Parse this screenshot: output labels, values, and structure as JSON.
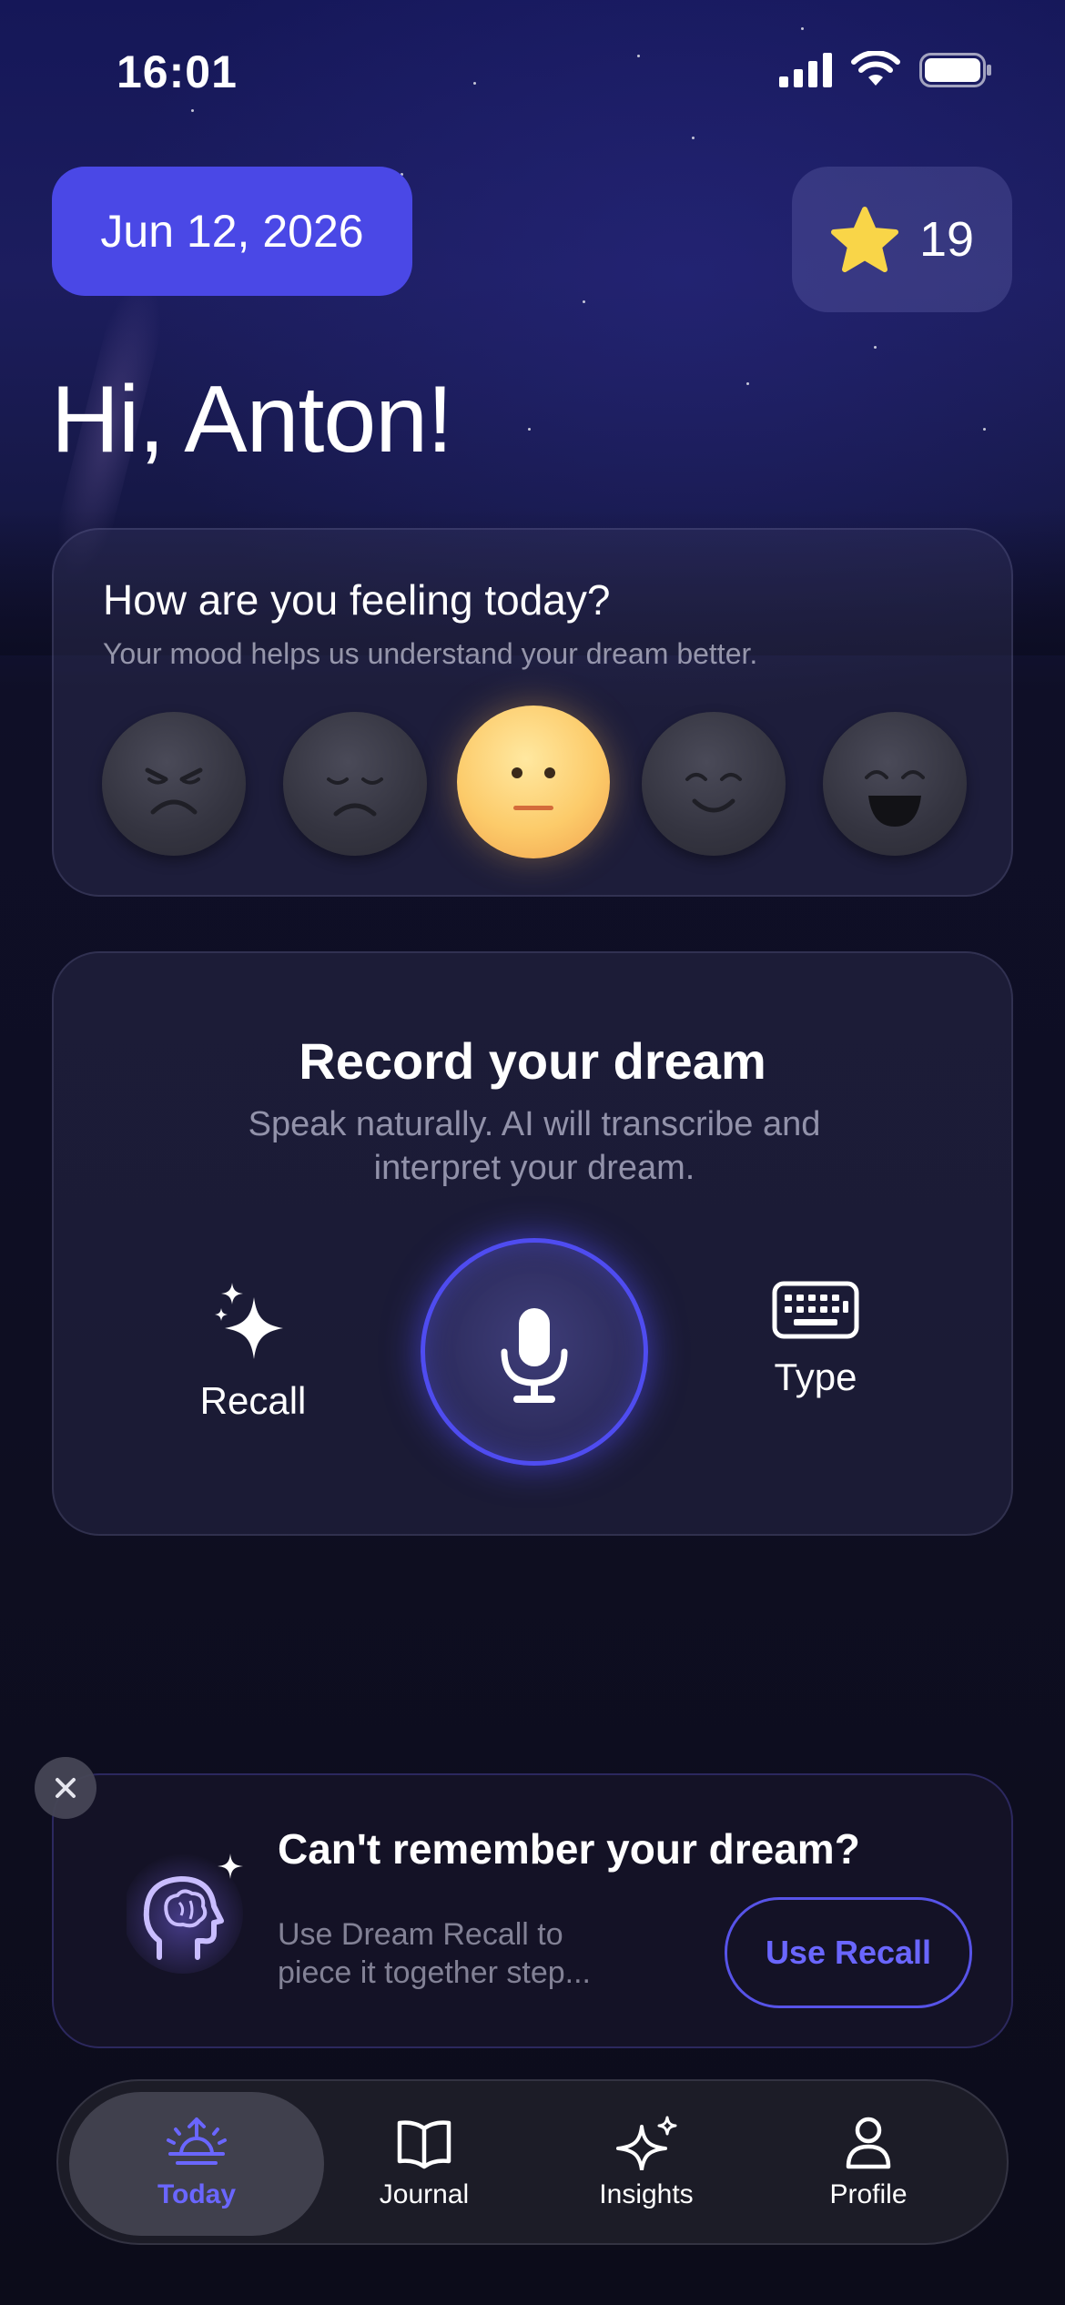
{
  "status_bar": {
    "time": "16:01",
    "icons": [
      "signal-icon",
      "wifi-icon",
      "battery-icon"
    ]
  },
  "header": {
    "date": "Jun 12, 2026",
    "stars_count": "19",
    "greeting": "Hi, Anton!"
  },
  "mood": {
    "title": "How are you feeling today?",
    "subtitle": "Your mood helps us understand your dream better.",
    "options": [
      "angry",
      "sad",
      "neutral",
      "content",
      "happy"
    ],
    "selected": "neutral"
  },
  "record": {
    "title": "Record your dream",
    "subtitle": "Speak naturally. AI will transcribe and interpret your dream.",
    "recall_label": "Recall",
    "type_label": "Type"
  },
  "recall_banner": {
    "title": "Can't remember your dream?",
    "subtitle": "Use Dream Recall to piece it together step...",
    "button_label": "Use Recall"
  },
  "tabs": [
    {
      "label": "Today",
      "icon": "sunrise-icon",
      "active": true
    },
    {
      "label": "Journal",
      "icon": "book-icon",
      "active": false
    },
    {
      "label": "Insights",
      "icon": "sparkles-icon",
      "active": false
    },
    {
      "label": "Profile",
      "icon": "person-icon",
      "active": false
    }
  ],
  "colors": {
    "accent": "#4a48e6",
    "accent_text": "#6a66ff",
    "mood_selected": "#fccb6a",
    "star": "#f9d548"
  }
}
